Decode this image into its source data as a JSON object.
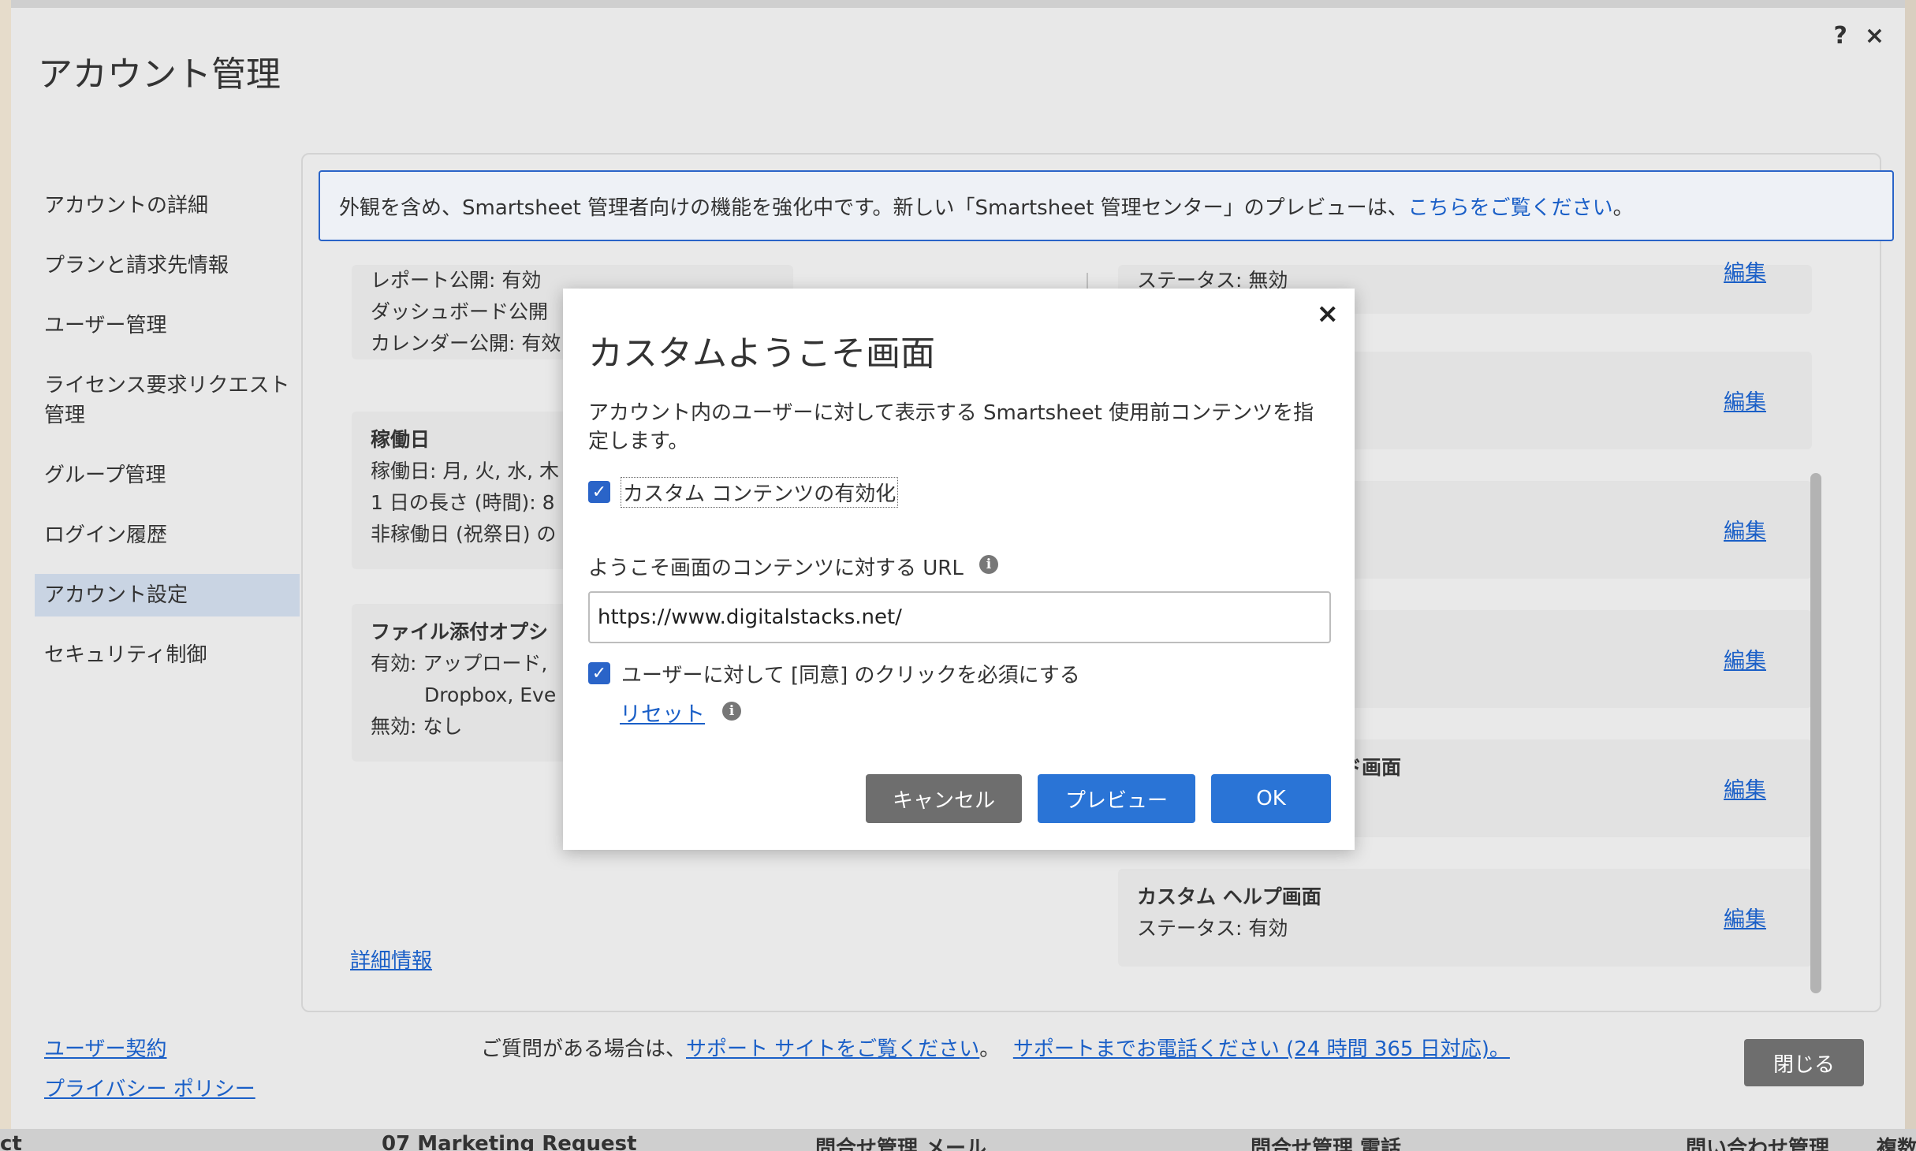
{
  "admin": {
    "title": "アカウント管理",
    "help_icon": "?",
    "close_icon": "×"
  },
  "sidebar": {
    "items": [
      {
        "label": "アカウントの詳細"
      },
      {
        "label": "プランと請求先情報"
      },
      {
        "label": "ユーザー管理"
      },
      {
        "label": "ライセンス要求リクエスト管理"
      },
      {
        "label": "グループ管理"
      },
      {
        "label": "ログイン履歴"
      },
      {
        "label": "アカウント設定"
      },
      {
        "label": "セキュリティ制御"
      }
    ]
  },
  "bottom_links": {
    "user_agreement": "ユーザー契約",
    "privacy_policy": "プライバシー ポリシー"
  },
  "notice": {
    "text": "外観を含め、Smartsheet 管理者向けの機能を強化中です。新しい「Smartsheet 管理センター」のプレビューは、",
    "link": "こちらをご覧ください",
    "tail": "。"
  },
  "cards": {
    "publish": {
      "line1": "レポート公開: 有効",
      "line2": "ダッシュボード公開",
      "line3": "カレンダー公開: 有效"
    },
    "workdays": {
      "title": "稼働日",
      "line1": "稼働日: 月, 火, 水, 木",
      "line2": "1 日の長さ (時間): 8",
      "line3": "非稼働日 (祝祭日) の"
    },
    "attachments": {
      "title": "ファイル添付オプシ",
      "line1": "有効: アップロード,",
      "line2": "Dropbox, Eve",
      "line3": "無効: なし"
    },
    "status_top": "ステータス: 無効",
    "landing_suffix": "ド画面",
    "custom_help": {
      "title": "カスタム ヘルプ画面",
      "status": "ステータス: 有効"
    },
    "edit_label": "編集"
  },
  "detail_link": "詳細情報",
  "footer": {
    "prefix": "ご質問がある場合は、",
    "support_site": "サポート サイトをご覧ください",
    "sep": "。",
    "phone": "サポートまでお電話ください (24 時間 365 日対応)。"
  },
  "close_button": "閉じる",
  "modal": {
    "title": "カスタムようこそ画面",
    "close": "×",
    "description": "アカウント内のユーザーに対して表示する Smartsheet 使用前コンテンツを指定します。",
    "enable_custom": "カスタム コンテンツの有効化",
    "url_label": "ようこそ画面のコンテンツに対する URL",
    "url_value": "https://www.digitalstacks.net/",
    "require_agree": "ユーザーに対して [同意] のクリックを必須にする",
    "reset": "リセット",
    "cancel": "キャンセル",
    "preview": "プレビュー",
    "ok": "OK"
  },
  "background_bottom": {
    "items": [
      "ct",
      "07 Marketing Request",
      "問合せ管理 メール",
      "問合せ管理 電話",
      "問い合わせ管理",
      "複数"
    ]
  },
  "colors": {
    "accent": "#2a74d6",
    "link": "#1a5fc7",
    "active_nav": "#c9d4e3"
  }
}
